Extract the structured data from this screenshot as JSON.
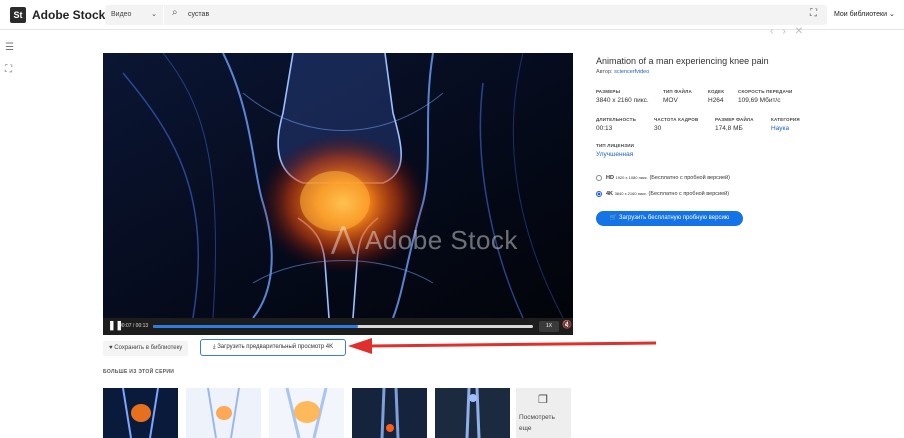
{
  "header": {
    "logo_mark": "St",
    "logo_text": "Adobe Stock",
    "type_select": "Видео",
    "search_value": "сустав",
    "libraries_label": "Мои библиотеки"
  },
  "player": {
    "watermark": "Adobe Stock",
    "time": "00:07 / 00:13",
    "progress": 0.54,
    "speed": "1X"
  },
  "actions": {
    "save_label": "Сохранить в библиотеку",
    "download_preview_label": "Загрузить предварительный просмотр 4K"
  },
  "series": {
    "heading": "БОЛЬШЕ ИЗ ЭТОЙ СЕРИИ",
    "see_more_label": "Посмотреть еще"
  },
  "details": {
    "title": "Animation of a man experiencing knee pain",
    "author_prefix": "Автор:",
    "author": "sciencerfvideo",
    "rows": [
      [
        {
          "label": "РАЗМЕРЫ",
          "value": "3840 x 2160 пикс."
        },
        {
          "label": "ТИП ФАЙЛА",
          "value": "MOV"
        },
        {
          "label": "КОДЕК",
          "value": "H264"
        },
        {
          "label": "СКОРОСТЬ ПЕРЕДАЧИ",
          "value": "109,69 Мбит/с"
        }
      ],
      [
        {
          "label": "ДЛИТЕЛЬНОСТЬ",
          "value": "00:13"
        },
        {
          "label": "ЧАСТОТА КАДРОВ",
          "value": "30"
        },
        {
          "label": "РАЗМЕР ФАЙЛА",
          "value": "174,8 МБ"
        },
        {
          "label": "КАТЕГОРИЯ",
          "value": "Наука"
        }
      ]
    ],
    "license_label": "ТИП ЛИЦЕНЗИИ",
    "license_value": "Улучшенная",
    "options": [
      {
        "name": "HD",
        "size": "1920 x 1080 пикс.",
        "note": "(Бесплатно с пробной версией)",
        "selected": false
      },
      {
        "name": "4K",
        "size": "3840 x 2160 пикс.",
        "note": "(Бесплатно с пробной версией)",
        "selected": true
      }
    ],
    "free_button": "Загрузить бесплатную пробную версию"
  },
  "colors": {
    "accent": "#1473e6",
    "annotation_arrow": "#e0302b"
  }
}
